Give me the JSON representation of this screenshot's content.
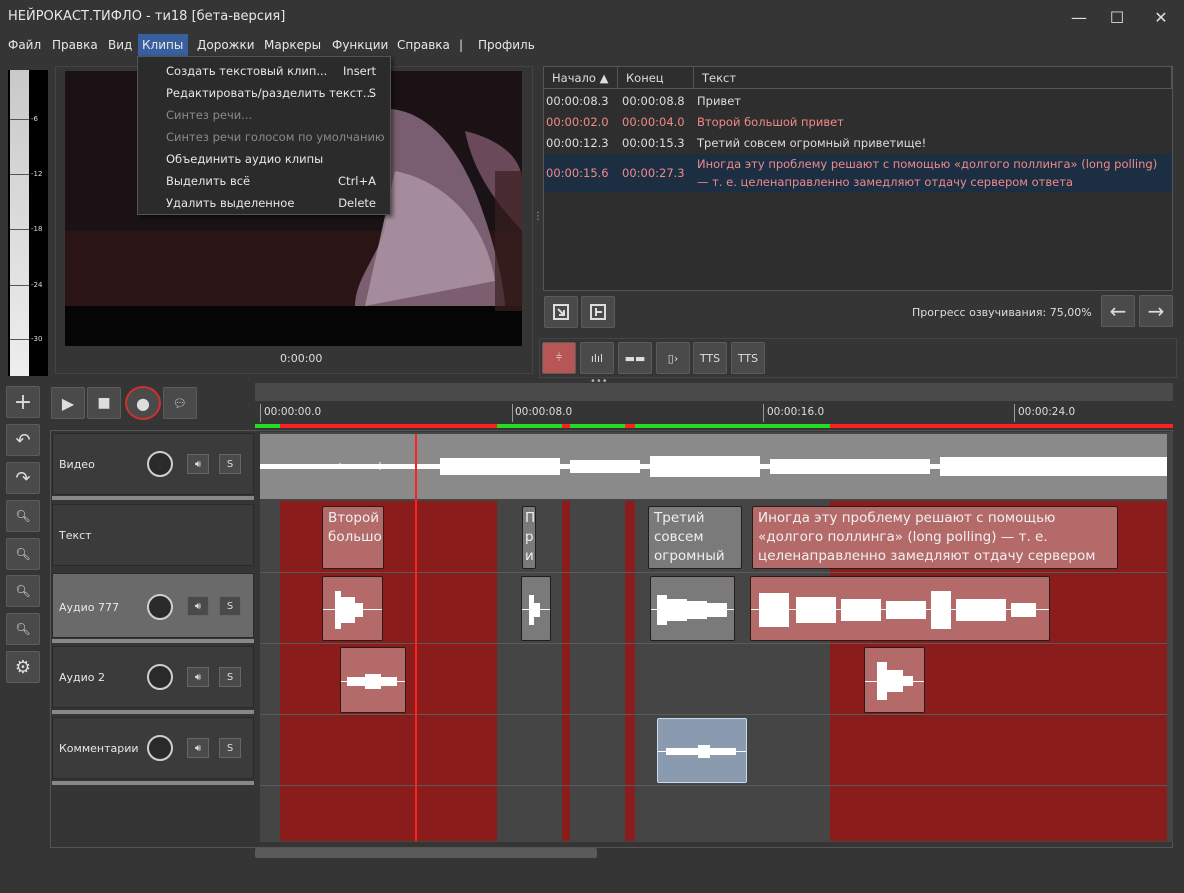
{
  "window": {
    "title": "НЕЙРОКАСТ.ТИФЛО - ти18 [бета-версия]",
    "minimize": "—",
    "maximize": "☐",
    "close": "✕"
  },
  "menu": {
    "items": [
      "Файл",
      "Правка",
      "Вид",
      "Клипы",
      "Дорожки",
      "Маркеры",
      "Функции",
      "Справка",
      "|",
      "Профиль"
    ],
    "active": "Клипы"
  },
  "clips_menu": [
    {
      "label": "Создать текстовый клип...",
      "shortcut": "Insert",
      "enabled": true
    },
    {
      "label": "Редактировать/разделить текст...",
      "shortcut": "S",
      "enabled": true
    },
    {
      "label": "Синтез речи...",
      "shortcut": "",
      "enabled": false
    },
    {
      "label": "Синтез речи голосом по умолчанию",
      "shortcut": "",
      "enabled": false
    },
    {
      "label": "Объединить аудио клипы",
      "shortcut": "",
      "enabled": true
    },
    {
      "label": "Выделить всё",
      "shortcut": "Ctrl+A",
      "enabled": true
    },
    {
      "label": "Удалить выделенное",
      "shortcut": "Delete",
      "enabled": true
    }
  ],
  "vu_meter": {
    "labels": [
      "-6",
      "-12",
      "-18",
      "-24",
      "-30"
    ]
  },
  "video": {
    "time": "0:00:00"
  },
  "subtitles": {
    "columns": [
      "Начало ▲",
      "Конец",
      "Текст"
    ],
    "rows": [
      {
        "start": "00:00:08.3",
        "end": "00:00:08.8",
        "text": "Привет",
        "color": "#dddddd"
      },
      {
        "start": "00:00:02.0",
        "end": "00:00:04.0",
        "text": "Второй большой привет",
        "color": "#f08a8a"
      },
      {
        "start": "00:00:12.3",
        "end": "00:00:15.3",
        "text": "Третий совсем огромный приветище!",
        "color": "#dddddd"
      },
      {
        "start": "00:00:15.6",
        "end": "00:00:27.3",
        "text": "Иногда эту проблему решают с помощью «долгого поллинга» (long polling)",
        "text2": "— т. е. целенаправленно замедляют отдачу сервером ответа",
        "color": "#f08a8a",
        "selected": true
      }
    ],
    "progress_label": "Прогресс озвучивания: 75,00%",
    "progress": 0.75
  },
  "toolbar": {
    "tts1": "TTS",
    "tts2": "TTS"
  },
  "ruler": {
    "labels": [
      "00:00:00.0",
      "00:00:08.0",
      "00:00:16.0",
      "00:00:24.0"
    ]
  },
  "tracks": [
    {
      "name": "Видео",
      "solo": "S"
    },
    {
      "name": "Текст"
    },
    {
      "name": "Аудио 777",
      "solo": "S"
    },
    {
      "name": "Аудио 2",
      "solo": "S"
    },
    {
      "name": "Комментарии",
      "solo": "S"
    }
  ],
  "text_clips": [
    {
      "text": "Второй большой"
    },
    {
      "text": "П р и"
    },
    {
      "text": "Третий совсем огромный"
    },
    {
      "text": "Иногда эту проблему решают с помощью «долгого поллинга» (long polling) — т. е. целенаправленно замедляют отдачу сервером ответа"
    }
  ],
  "colors": {
    "accent": "#3a5f9f",
    "zone_red": "#8b1c1c",
    "clip_red": "#b56a6a",
    "playhead": "#ff2020",
    "green": "#22dd22"
  }
}
